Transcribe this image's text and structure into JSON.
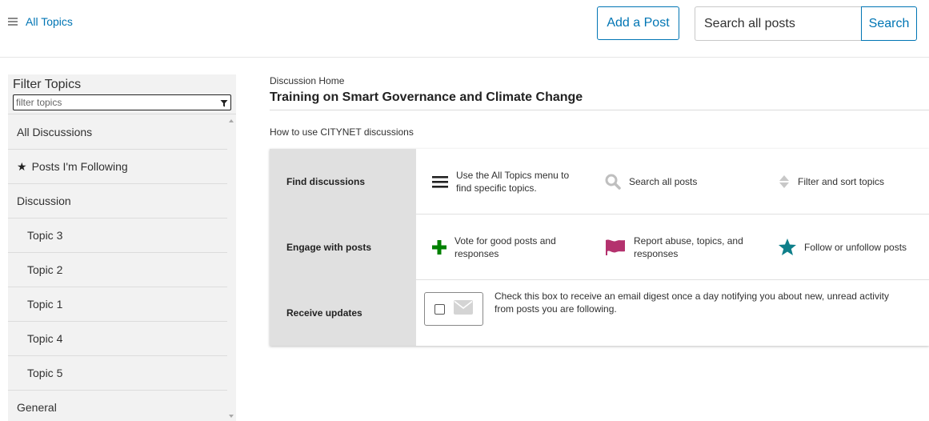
{
  "header": {
    "all_topics_label": "All Topics",
    "add_post_label": "Add a Post",
    "search_placeholder": "Search all posts",
    "search_button_label": "Search"
  },
  "sidebar": {
    "filter_title": "Filter Topics",
    "filter_placeholder": "filter topics",
    "items": [
      {
        "label": "All Discussions",
        "icon": ""
      },
      {
        "label": "Posts I'm Following",
        "icon": "star-icon"
      },
      {
        "label": "Discussion",
        "icon": ""
      },
      {
        "label": "Topic 3",
        "icon": ""
      },
      {
        "label": "Topic 2",
        "icon": ""
      },
      {
        "label": "Topic 1",
        "icon": ""
      },
      {
        "label": "Topic 4",
        "icon": ""
      },
      {
        "label": "Topic 5",
        "icon": ""
      },
      {
        "label": "General",
        "icon": ""
      }
    ]
  },
  "main": {
    "breadcrumb": "Discussion Home",
    "title": "Training on Smart Governance and Climate Change",
    "howto_heading": "How to use CITYNET discussions",
    "rows": [
      {
        "label": "Find discussions",
        "cells": [
          {
            "icon": "menu-icon",
            "text": "Use the All Topics menu to find specific topics."
          },
          {
            "icon": "search-icon",
            "text": "Search all posts"
          },
          {
            "icon": "sort-icon",
            "text": "Filter and sort topics"
          }
        ]
      },
      {
        "label": "Engage with posts",
        "cells": [
          {
            "icon": "plus-icon",
            "text": "Vote for good posts and responses"
          },
          {
            "icon": "flag-icon",
            "text": "Report abuse, topics, and responses"
          },
          {
            "icon": "star-icon",
            "text": "Follow or unfollow posts"
          }
        ]
      },
      {
        "label": "Receive updates",
        "digest_text": "Check this box to receive an email digest once a day notifying you about new, unread activity from posts you are following.",
        "digest_checked": false
      }
    ]
  },
  "colors": {
    "link": "#0075b4",
    "plus": "#008100",
    "flag": "#b4326e",
    "star": "#0e7f8a",
    "sidebar_bg": "#f2f2f2",
    "row_label_bg": "#e0e0e0"
  }
}
